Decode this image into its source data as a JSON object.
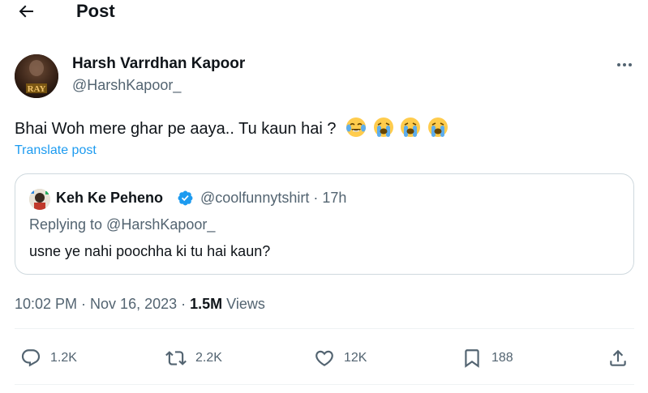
{
  "header": {
    "title": "Post",
    "back_icon": "arrow-left-icon"
  },
  "post": {
    "author": {
      "name": "Harsh Varrdhan Kapoor",
      "handle": "@HarshKapoor_",
      "avatar_text": "RAY"
    },
    "text": "Bhai Woh mere ghar pe aaya.. Tu kaun hai ?",
    "emojis": [
      "face-with-tears-of-joy",
      "loudly-crying-face",
      "loudly-crying-face",
      "loudly-crying-face"
    ],
    "translate_label": "Translate post",
    "timestamp": "10:02 PM · Nov 16, 2023 · ",
    "views_count": "1.5M",
    "views_label": " Views"
  },
  "quote": {
    "name": "Keh Ke Peheno",
    "handle_time": "@coolfunnytshirt · 17h",
    "replying_to": "Replying to @HarshKapoor_",
    "text": "usne ye nahi poochha ki tu hai kaun?"
  },
  "actions": {
    "reply_count": "1.2K",
    "repost_count": "2.2K",
    "like_count": "12K",
    "bookmark_count": "188"
  },
  "colors": {
    "accent": "#1d9bf0",
    "text": "#0f1419",
    "secondary": "#536471",
    "border": "#cfd9de"
  }
}
